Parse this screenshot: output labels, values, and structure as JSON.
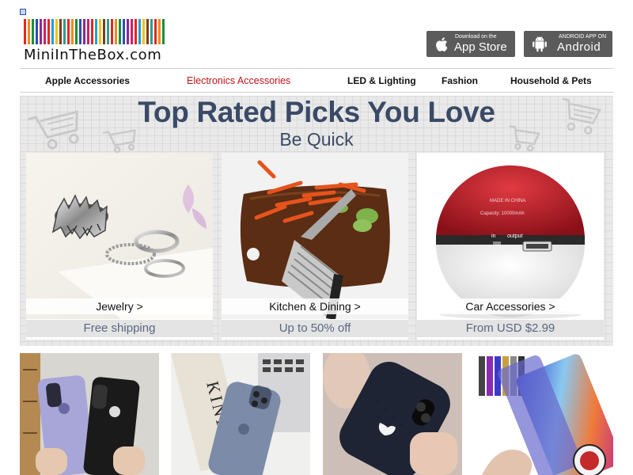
{
  "header": {
    "logo_text": "MiniInTheBox.com",
    "logo_colors": [
      "#e6271c",
      "#f08a1d",
      "#1a8f3a",
      "#2a4fb0",
      "#8a2b8f",
      "#d11f6e",
      "#e6271c",
      "#1aa0d8",
      "#f0c419",
      "#7b3b1a",
      "#2a9d8f",
      "#e6271c",
      "#f08a1d",
      "#1a8f3a",
      "#2a4fb0",
      "#8a2b8f",
      "#d11f6e",
      "#e6271c",
      "#1aa0d8",
      "#f0c419",
      "#7b3b1a",
      "#2a9d8f",
      "#e6271c",
      "#f08a1d",
      "#1a8f3a",
      "#2a4fb0",
      "#8a2b8f",
      "#d11f6e",
      "#e6271c",
      "#1aa0d8",
      "#f0c419",
      "#7b3b1a",
      "#2a9d8f",
      "#e6271c",
      "#f08a1d",
      "#1a8f3a"
    ],
    "app_store": {
      "small": "Download on the",
      "big": "App Store",
      "icon": "apple-icon"
    },
    "google_play": {
      "small": "ANDROID APP ON",
      "big": "Android",
      "icon": "android-icon"
    }
  },
  "nav": [
    {
      "label": "Apple Accessories"
    },
    {
      "label": "Electronics Accessories",
      "active": true
    },
    {
      "label": "LED & Lighting"
    },
    {
      "label": "Fashion"
    },
    {
      "label": "Household & Pets"
    }
  ],
  "banner": {
    "headline": "Top Rated Picks You Love",
    "sub": "Be Quick"
  },
  "cards": [
    {
      "title": "Jewelry >",
      "promo": "Free shipping"
    },
    {
      "title": "Kitchen & Dining >",
      "promo": "Up to 50% off"
    },
    {
      "title": "Car Accessories >",
      "promo": "From USD $2.99",
      "product_text": [
        "MADE IN CHINA",
        "Capacity: 10000mAh",
        "in",
        "output"
      ]
    }
  ],
  "colors": {
    "accent": "#c0141c",
    "headline": "#3a4a66",
    "button": "#5b5b5b"
  }
}
